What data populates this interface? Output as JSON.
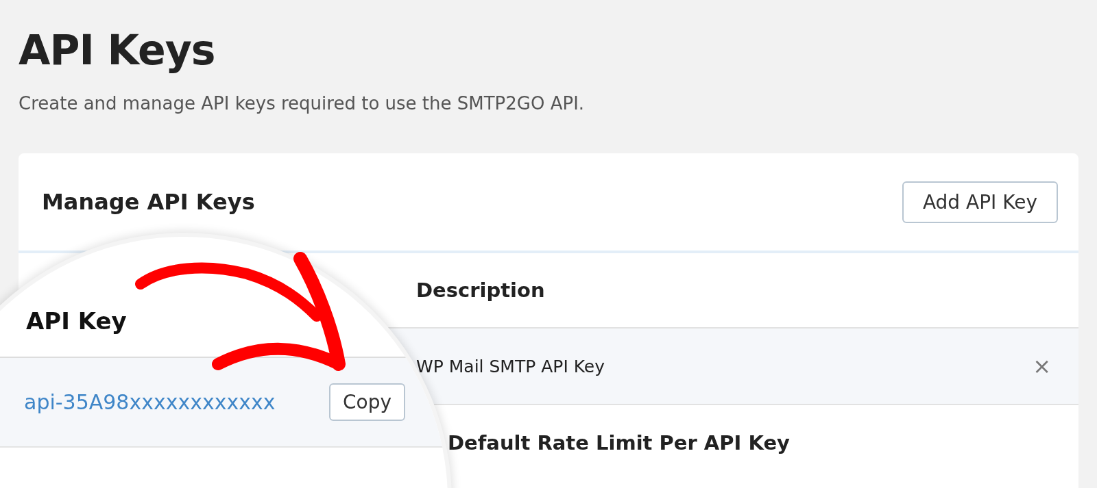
{
  "page": {
    "title": "API Keys",
    "subtitle": "Create and manage API keys required to use the SMTP2GO API."
  },
  "card": {
    "title": "Manage API Keys",
    "add_button": "Add API Key",
    "columns": [
      "Description"
    ],
    "rows": [
      {
        "description": "WP Mail SMTP API Key",
        "remove": "×"
      }
    ],
    "section_title": "Default Rate Limit Per API Key"
  },
  "magnifier": {
    "column": "API Key",
    "key": "api-35A98xxxxxxxxxxxx",
    "copy_button": "Copy"
  }
}
